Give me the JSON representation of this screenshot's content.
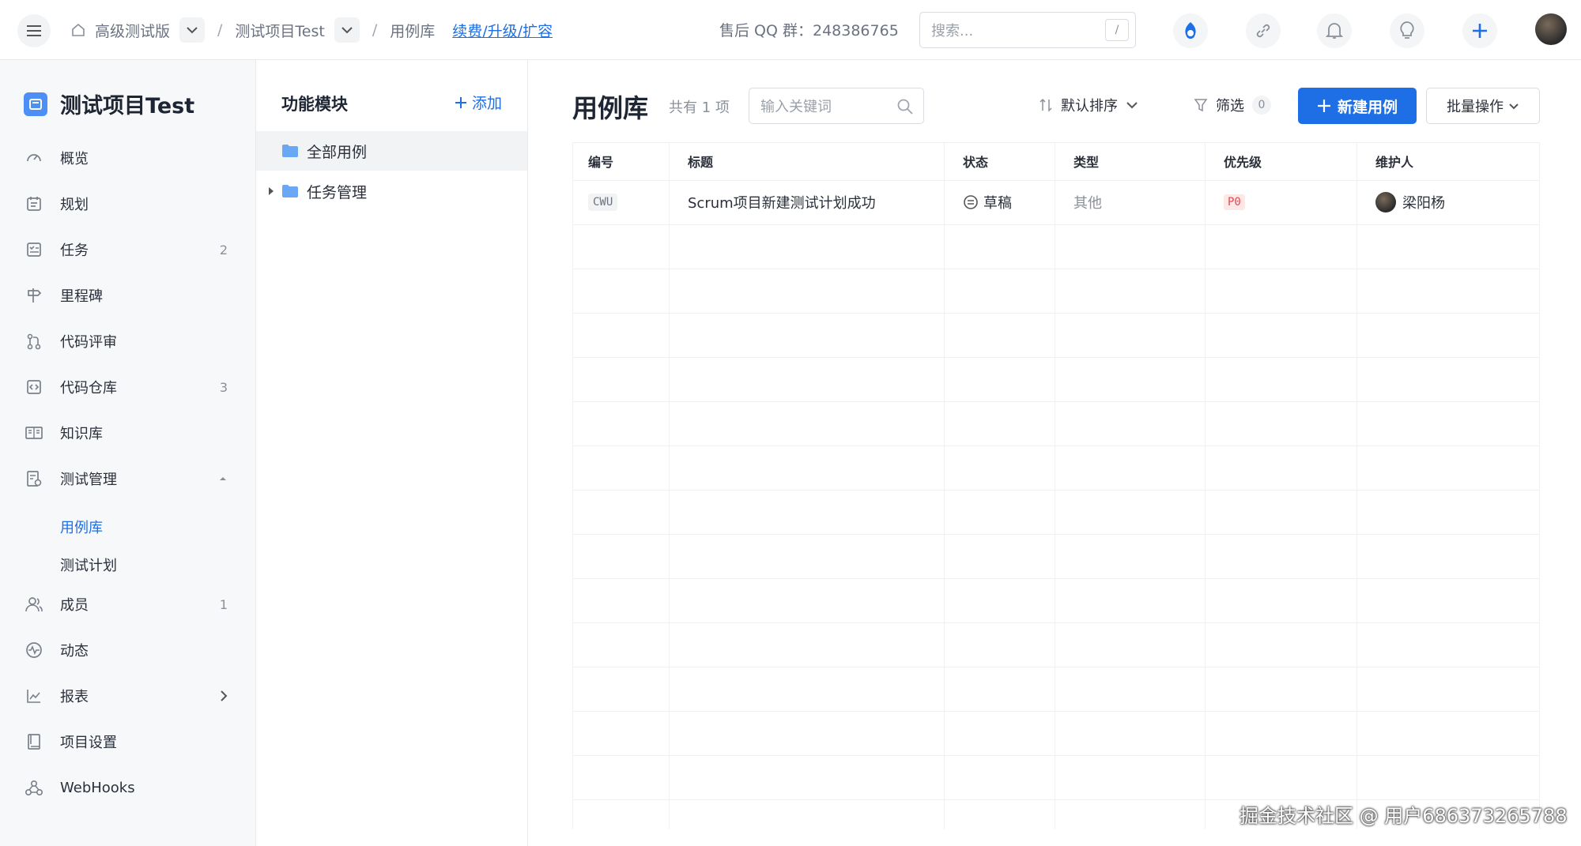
{
  "topbar": {
    "crumbs": [
      "高级测试版",
      "测试项目Test",
      "用例库"
    ],
    "renew_link": "续费/升级/扩容",
    "qq_group": "售后 QQ 群：248386765",
    "search_placeholder": "搜索...",
    "search_shortcut": "/"
  },
  "sidebar": {
    "project_name": "测试项目Test",
    "items": [
      {
        "label": "概览",
        "icon": "gauge-icon",
        "count": ""
      },
      {
        "label": "规划",
        "icon": "calendar-icon",
        "count": ""
      },
      {
        "label": "任务",
        "icon": "task-icon",
        "count": "2"
      },
      {
        "label": "里程碑",
        "icon": "signpost-icon",
        "count": ""
      },
      {
        "label": "代码评审",
        "icon": "merge-icon",
        "count": ""
      },
      {
        "label": "代码仓库",
        "icon": "code-icon",
        "count": "3"
      },
      {
        "label": "知识库",
        "icon": "book-icon",
        "count": ""
      },
      {
        "label": "测试管理",
        "icon": "test-icon",
        "count": ""
      },
      {
        "label": "成员",
        "icon": "users-icon",
        "count": "1"
      },
      {
        "label": "动态",
        "icon": "activity-icon",
        "count": ""
      },
      {
        "label": "报表",
        "icon": "chart-icon",
        "count": ""
      },
      {
        "label": "项目设置",
        "icon": "settings-book-icon",
        "count": ""
      },
      {
        "label": "WebHooks",
        "icon": "webhook-icon",
        "count": ""
      }
    ],
    "sub_items": [
      {
        "label": "用例库",
        "active": true
      },
      {
        "label": "测试计划",
        "active": false
      }
    ]
  },
  "modules": {
    "title": "功能模块",
    "add_label": "添加",
    "tree": [
      {
        "label": "全部用例",
        "active": true,
        "expandable": false
      },
      {
        "label": "任务管理",
        "active": false,
        "expandable": true
      }
    ]
  },
  "main": {
    "title": "用例库",
    "count": "共有 1 项",
    "keyword_placeholder": "输入关键词",
    "sort_label": "默认排序",
    "filter_label": "筛选",
    "filter_count": "0",
    "new_button": "新建用例",
    "batch_button": "批量操作",
    "columns": [
      "编号",
      "标题",
      "状态",
      "类型",
      "优先级",
      "维护人"
    ],
    "rows": [
      {
        "code": "CWU",
        "title": "Scrum项目新建测试计划成功",
        "status": "草稿",
        "type": "其他",
        "priority": "P0",
        "owner": "梁阳杨"
      }
    ]
  },
  "watermark": "掘金技术社区 @ 用户686373265788",
  "colors": {
    "accent": "#1e6fe6",
    "danger": "#e5484d",
    "sidebar_bg": "#f7f8fa"
  }
}
